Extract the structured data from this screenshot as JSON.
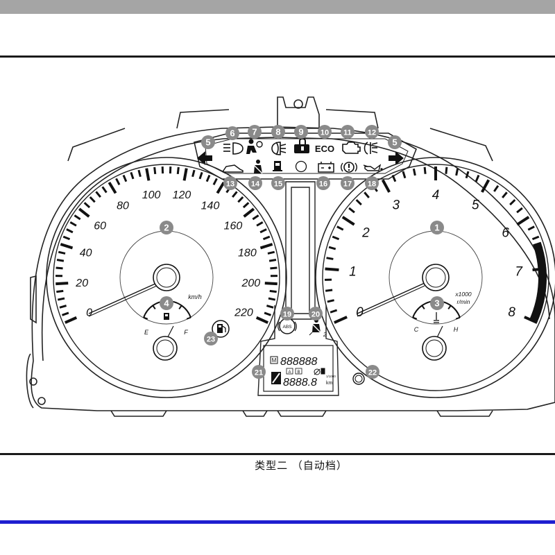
{
  "caption": "类型二 （自动档）",
  "colors": {
    "band": "#a5a5a5",
    "rule": "#1a1a1a",
    "accent_rule": "#1f1fd0",
    "callout": "#8a8a8a"
  },
  "speedometer": {
    "ticks": [
      "0",
      "20",
      "40",
      "60",
      "80",
      "100",
      "120",
      "140",
      "160",
      "180",
      "200",
      "220"
    ],
    "unit": "km/h",
    "fuel_gauge": {
      "empty": "E",
      "full": "F"
    }
  },
  "tachometer": {
    "ticks": [
      "0",
      "1",
      "2",
      "3",
      "4",
      "5",
      "6",
      "7",
      "8"
    ],
    "unit_line1": "x1000",
    "unit_line2": "r/min",
    "temp_gauge": {
      "cold": "C",
      "hot": "H"
    }
  },
  "indicators": {
    "eco": "ECO",
    "abs": "ABS",
    "seatbelt_2": "2"
  },
  "display": {
    "gear_marker": "M",
    "odometer_top": "888888",
    "odometer_bottom": "8888.8",
    "boxes": [
      "A",
      "B"
    ],
    "km": "km",
    "small_1000": "1/1000"
  },
  "callouts": [
    "1",
    "2",
    "3",
    "4",
    "5",
    "6",
    "7",
    "8",
    "9",
    "10",
    "11",
    "12",
    "13",
    "14",
    "15",
    "16",
    "17",
    "18",
    "19",
    "20",
    "21",
    "22",
    "23"
  ]
}
